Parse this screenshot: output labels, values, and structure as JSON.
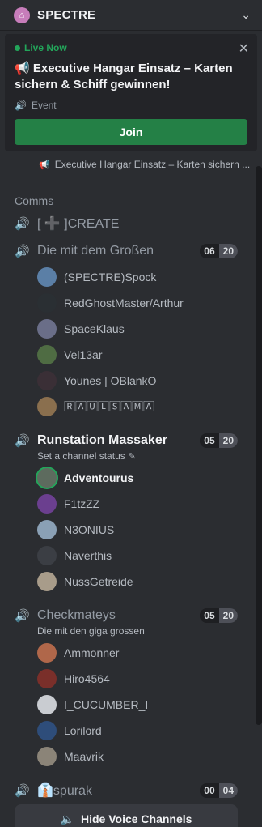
{
  "header": {
    "server_name": "SPECTRE",
    "server_icon": "house-icon"
  },
  "event": {
    "live_label": "Live Now",
    "title": "Executive Hangar Einsatz – Karten sichern & Schiff gewinnen!",
    "type_label": "Event",
    "join_label": "Join",
    "channel_event_line": "Executive Hangar Einsatz – Karten sichern ..."
  },
  "category": "Comms",
  "channels": [
    {
      "name": "[ ➕ ]CREATE",
      "active": false
    },
    {
      "name": "Die mit dem Großen",
      "active": false,
      "count": "06",
      "limit": "20",
      "users": [
        {
          "name": "(SPECTRE)Spock",
          "color": "#5b7fa6"
        },
        {
          "name": "RedGhostMaster/Arthur",
          "color": "#2a2f33"
        },
        {
          "name": "SpaceKlaus",
          "color": "#6a6e88"
        },
        {
          "name": "Vel13ar",
          "color": "#4f6c43"
        },
        {
          "name": "Younes | OBlankO",
          "color": "#3a2f36"
        },
        {
          "name": "🅁🄰🅄🄻🅂🄰🄼🄰",
          "color": "#8a6f4e"
        }
      ]
    },
    {
      "name": "Runstation Massaker",
      "active": true,
      "count": "05",
      "limit": "20",
      "status": "Set a channel status",
      "users": [
        {
          "name": "Adventourus",
          "color": "#5d6b5e",
          "speaking": true
        },
        {
          "name": "F1tzZZ",
          "color": "#6b3f8f"
        },
        {
          "name": "N3ONIUS",
          "color": "#8aa0b5"
        },
        {
          "name": "Naverthis",
          "color": "#3b3e44"
        },
        {
          "name": "NussGetreide",
          "color": "#a89c8a"
        }
      ]
    },
    {
      "name": "Checkmateys",
      "active": false,
      "count": "05",
      "limit": "20",
      "status": "Die mit den giga grossen",
      "users": [
        {
          "name": "Ammonner",
          "color": "#b0674a"
        },
        {
          "name": "Hiro4564",
          "color": "#7a2f2a"
        },
        {
          "name": "I_CUCUMBER_I",
          "color": "#c9ccd1"
        },
        {
          "name": "Lorilord",
          "color": "#2e4d7a"
        },
        {
          "name": "Maavrik",
          "color": "#8b8478"
        }
      ]
    },
    {
      "name": "👔spurak",
      "active": false,
      "count": "00",
      "limit": "04"
    }
  ],
  "footer": {
    "hide_label": "Hide Voice Channels"
  }
}
